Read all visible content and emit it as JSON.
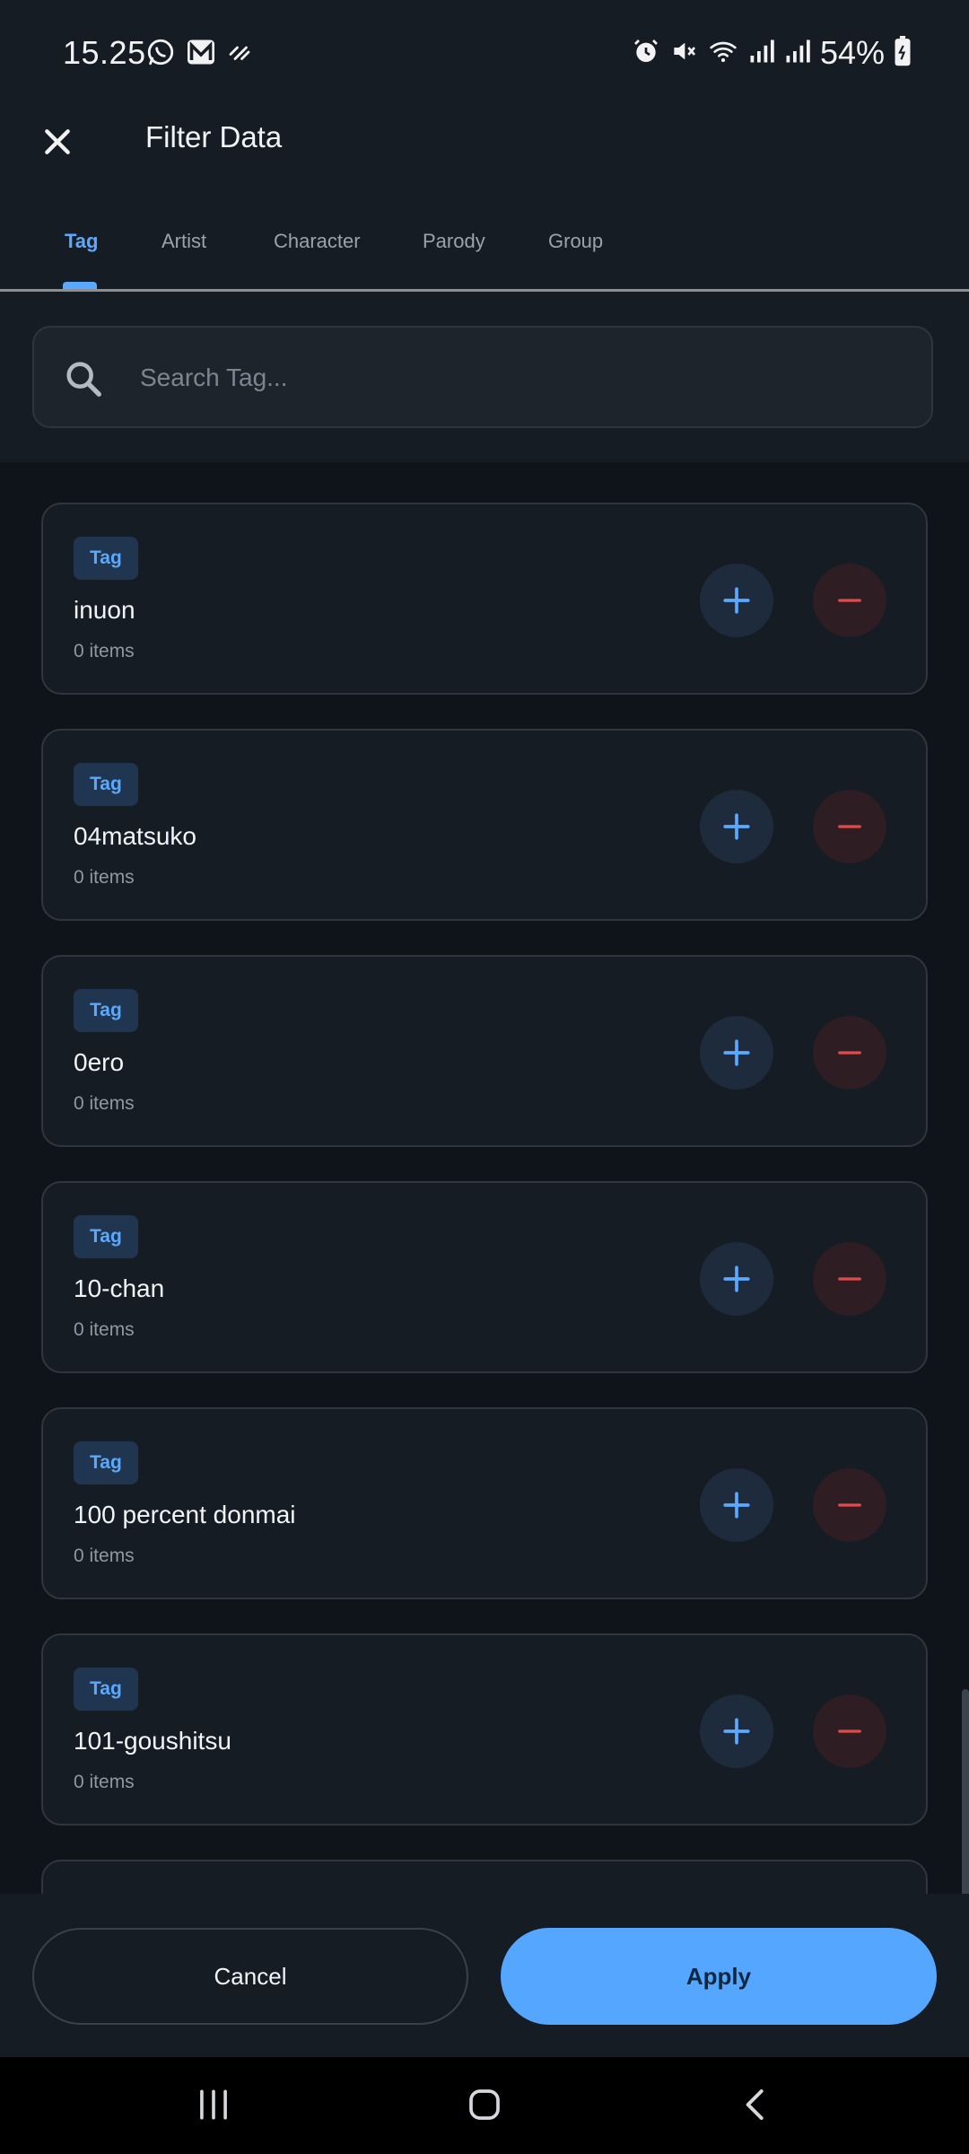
{
  "status_bar": {
    "time": "15.25",
    "battery": "54%",
    "left_icons": [
      "whatsapp-icon",
      "mail-m-icon",
      "sync-wave-icon"
    ],
    "right_icons": [
      "alarm-icon",
      "mute-icon",
      "wifi-icon",
      "signal-icon",
      "signal-icon",
      "battery-icon"
    ]
  },
  "app_bar": {
    "title": "Filter Data",
    "close_icon": "close-icon"
  },
  "tabs": [
    {
      "label": "Tag",
      "active": true
    },
    {
      "label": "Artist",
      "active": false
    },
    {
      "label": "Character",
      "active": false
    },
    {
      "label": "Parody",
      "active": false
    },
    {
      "label": "Group",
      "active": false
    }
  ],
  "search": {
    "placeholder": "Search Tag...",
    "value": "",
    "icon": "search-icon"
  },
  "list": {
    "items": [
      {
        "badge": "Tag",
        "name": "inuon",
        "count": "0 items"
      },
      {
        "badge": "Tag",
        "name": "04matsuko",
        "count": "0 items"
      },
      {
        "badge": "Tag",
        "name": "0ero",
        "count": "0 items"
      },
      {
        "badge": "Tag",
        "name": "10-chan",
        "count": "0 items"
      },
      {
        "badge": "Tag",
        "name": "100 percent donmai",
        "count": "0 items"
      },
      {
        "badge": "Tag",
        "name": "101-goushitsu",
        "count": "0 items"
      }
    ]
  },
  "actions": {
    "cancel_label": "Cancel",
    "apply_label": "Apply"
  },
  "colors": {
    "accent": "#5aa9ff",
    "danger": "#e24b4b",
    "background": "#0f141b",
    "surface": "#161c24"
  }
}
